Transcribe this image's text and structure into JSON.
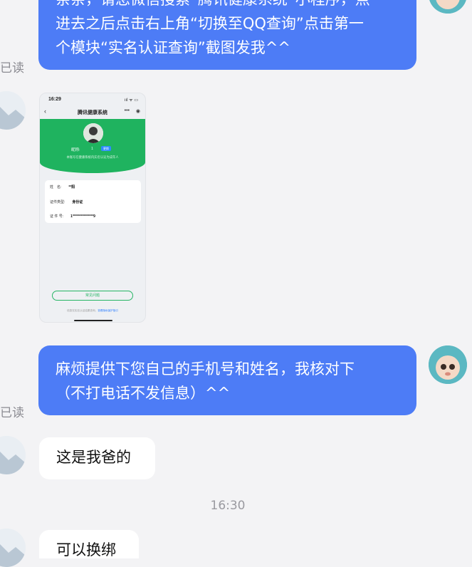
{
  "messages": {
    "m1": {
      "line1": "亲亲，请您微信搜索“腾讯健康系统”小程序，点",
      "line2": "进去之后点击右上角“切换至QQ查询”点击第一",
      "line3": "个模块“实名认证查询”截图发我^^",
      "read": "已读"
    },
    "m3": {
      "line1": "麻烦提供下您自己的手机号和姓名，我核对下",
      "line2": "（不打电话不发信息）^^",
      "read": "已读"
    },
    "m4": {
      "text": "这是我爸的"
    },
    "time": "16:30",
    "m5": {
      "text": "可以换绑"
    }
  },
  "screenshot": {
    "status_time": "16:29",
    "status_icons": "ııl ᯤ ▭",
    "app_title": "腾讯健康系统",
    "nickname_label": "昵称:",
    "nickname_value": "1",
    "badge": "更换",
    "banner_desc": "本账号在健康系统内实名认证为成年人",
    "fields": [
      {
        "label": "姓　名:",
        "value": "**阳"
      },
      {
        "label": "证件类型:",
        "value": "身份证"
      },
      {
        "label": "证 件 号:",
        "value": "1***************9"
      }
    ],
    "faq_button": "常见问题",
    "footer_text": "信息仅实名认证结果查询，",
    "footer_link": "查看隐私保护指引"
  },
  "colors": {
    "accent_bubble": "#4d7cf6",
    "mini_app_green": "#1fb35f",
    "background": "#f3f3f5"
  }
}
